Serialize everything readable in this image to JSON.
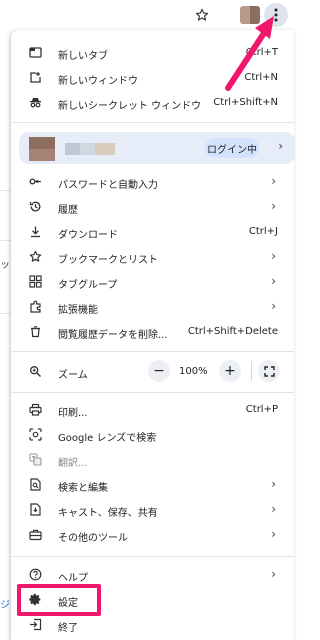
{
  "toolbar": {
    "star_icon": "star-outline-icon",
    "kebab_icon": "more-vert-icon",
    "kebab_color": "#dfe4ec"
  },
  "menu": {
    "group1": [
      {
        "label": "新しいタブ",
        "shortcut": "Ctrl+T",
        "icon": "new-tab-icon"
      },
      {
        "label": "新しいウィンドウ",
        "shortcut": "Ctrl+N",
        "icon": "new-window-icon"
      },
      {
        "label": "新しいシークレット ウィンドウ",
        "shortcut": "Ctrl+Shift+N",
        "icon": "incognito-icon"
      }
    ],
    "profile": {
      "status": "ログイン中"
    },
    "group2": [
      {
        "label": "パスワードと自動入力",
        "icon": "key-icon"
      },
      {
        "label": "履歴",
        "icon": "history-icon"
      },
      {
        "label": "ダウンロード",
        "shortcut": "Ctrl+J",
        "icon": "download-icon"
      },
      {
        "label": "ブックマークとリスト",
        "icon": "bookmark-star-icon"
      },
      {
        "label": "タブグループ",
        "icon": "tab-groups-icon"
      },
      {
        "label": "拡張機能",
        "icon": "extension-icon"
      },
      {
        "label": "閲覧履歴データを削除...",
        "shortcut": "Ctrl+Shift+Delete",
        "icon": "trash-icon"
      }
    ],
    "zoom": {
      "label": "ズーム",
      "value": "100%",
      "minus": "−",
      "plus": "+"
    },
    "group3": [
      {
        "label": "印刷...",
        "shortcut": "Ctrl+P",
        "icon": "print-icon"
      },
      {
        "label": "Google レンズで検索",
        "icon": "lens-icon"
      },
      {
        "label": "翻訳...",
        "icon": "translate-icon"
      },
      {
        "label": "検索と編集",
        "icon": "find-edit-icon"
      },
      {
        "label": "キャスト、保存、共有",
        "icon": "cast-save-share-icon"
      },
      {
        "label": "その他のツール",
        "icon": "toolbox-icon"
      }
    ],
    "group4": [
      {
        "label": "ヘルプ",
        "icon": "help-icon"
      },
      {
        "label": "設定",
        "icon": "settings-gear-icon"
      },
      {
        "label": "終了",
        "icon": "exit-icon"
      }
    ]
  },
  "annotation": {
    "highlight_color": "#f0176c",
    "arrow_color": "#f0176c"
  },
  "background_page": {
    "fragment_1": "ッ",
    "fragment_2": "ジ"
  }
}
